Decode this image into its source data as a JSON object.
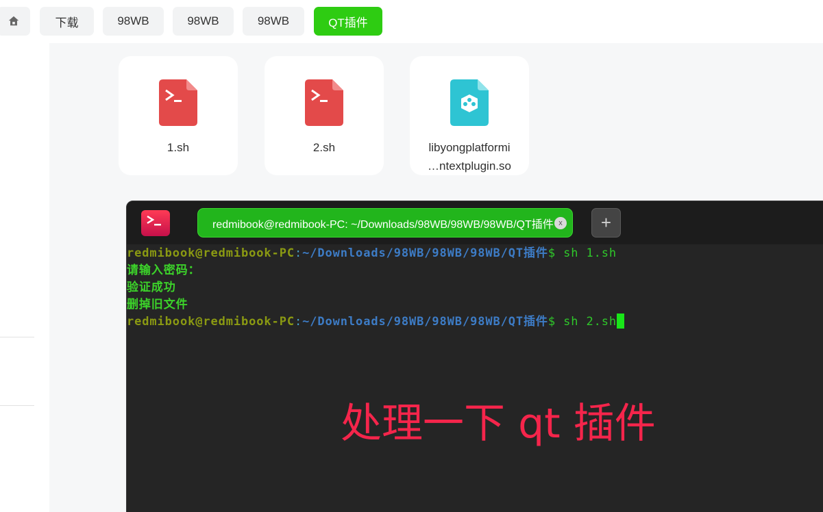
{
  "breadcrumb": {
    "items": [
      "下载",
      "98WB",
      "98WB",
      "98WB"
    ],
    "active": "QT插件"
  },
  "files": [
    {
      "name": "1.sh",
      "type": "shell-script"
    },
    {
      "name": "2.sh",
      "type": "shell-script"
    },
    {
      "name_line1": "libyongplatformi",
      "name_line2": "…ntextplugin.so",
      "type": "shared-library"
    }
  ],
  "terminal": {
    "tab_title": "redmibook@redmibook-PC: ~/Downloads/98WB/98WB/98WB/QT插件",
    "tab_close": "x",
    "new_tab": "+",
    "prompt_user": "redmibook@redmibook-PC",
    "prompt_colon": ":",
    "prompt_path": "~/Downloads/98WB/98WB/98WB/QT插件",
    "prompt_symbol": "$",
    "commands": [
      "sh 1.sh",
      "sh 2.sh"
    ],
    "output": [
      "请输入密码：",
      "验证成功",
      "删掉旧文件"
    ]
  },
  "overlay_caption": "处理一下 qt 插件",
  "colors": {
    "accent_green": "#2ecc12",
    "shell_icon_red": "#e34a4a",
    "lib_icon_teal": "#2ec4d3",
    "caption_red": "#f5254b"
  }
}
